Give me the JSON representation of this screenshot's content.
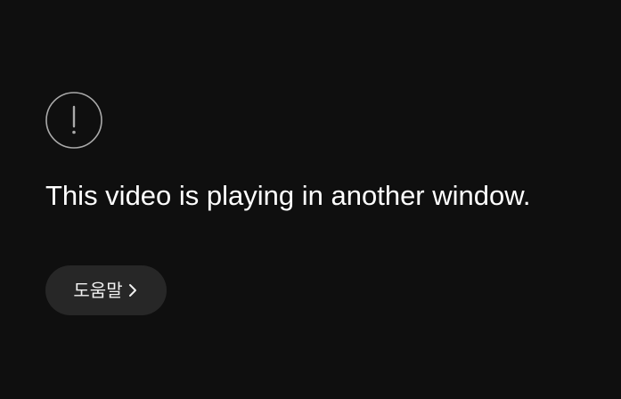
{
  "error_screen": {
    "icon": "alert-circle-icon",
    "message": "This video is playing in another window.",
    "help_button": {
      "label": "도움말",
      "icon": "chevron-right-icon"
    }
  },
  "colors": {
    "background": "#0f0f0f",
    "text": "#ffffff",
    "button_background": "#272727",
    "icon_stroke": "#aaaaaa"
  }
}
